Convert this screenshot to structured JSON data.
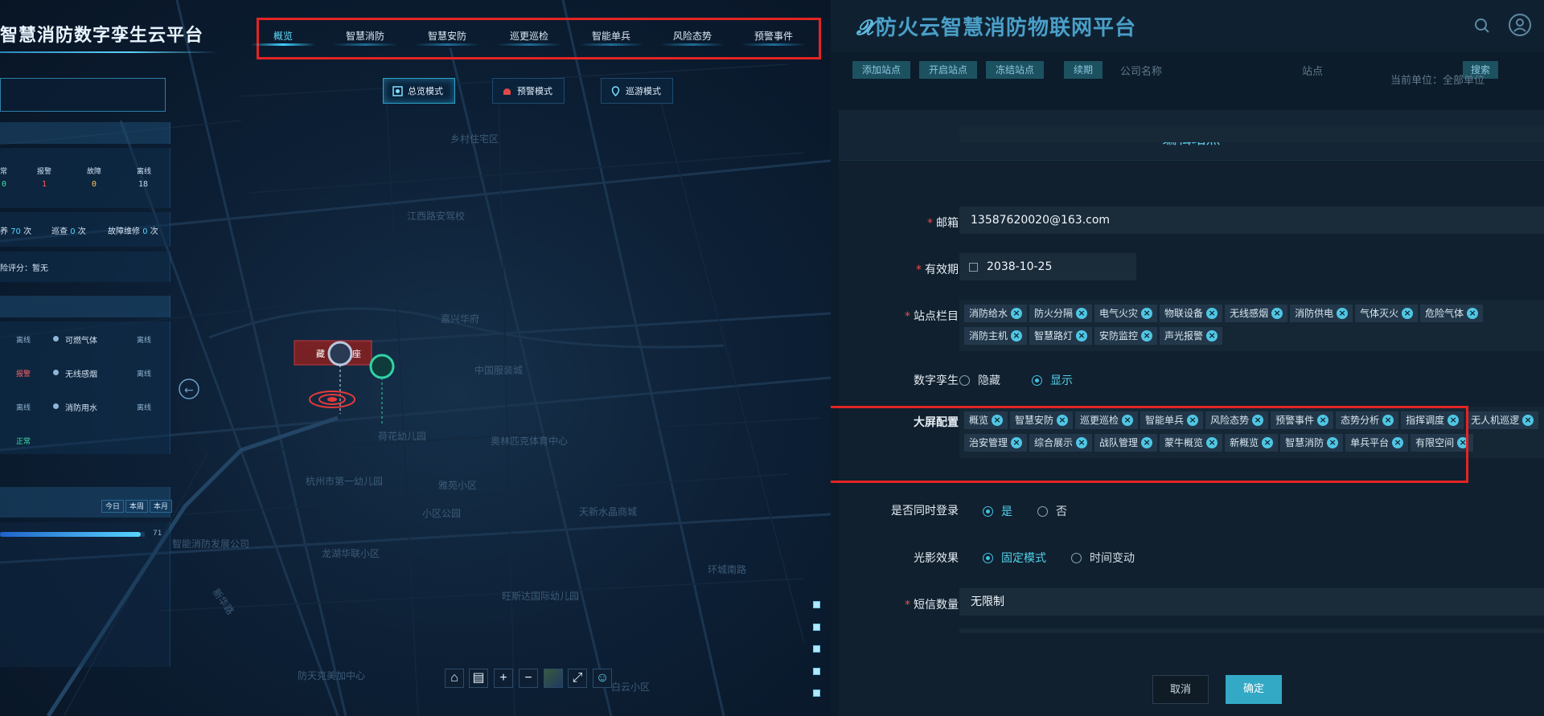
{
  "left": {
    "title": "智慧消防数字孪生云平台",
    "nav": [
      "概览",
      "智慧消防",
      "智慧安防",
      "巡更巡检",
      "智能单兵",
      "风险态势",
      "预警事件"
    ],
    "nav_active": "概览",
    "modes": [
      "总览模式",
      "预警模式",
      "巡游模式"
    ],
    "mode_active": "总览模式",
    "stats": [
      {
        "label": "常",
        "value": "0"
      },
      {
        "label": "报警",
        "value": "1"
      },
      {
        "label": "故障",
        "value": "0"
      },
      {
        "label": "离线",
        "value": "18"
      }
    ],
    "counts": [
      {
        "label": "养",
        "value": "70",
        "unit": "次"
      },
      {
        "label": "巡查",
        "value": "0",
        "unit": "次"
      },
      {
        "label": "故障维修",
        "value": "0",
        "unit": "次"
      }
    ],
    "risk_text": "险评分：暂无",
    "status_rows": [
      {
        "left": "离线",
        "name": "可燃气体",
        "right": "离线"
      },
      {
        "left": "报警",
        "name": "无线感烟",
        "right": "离线"
      },
      {
        "left": "离线",
        "name": "消防用水",
        "right": "离线"
      },
      {
        "left": "正常",
        "name": "",
        "right": ""
      }
    ],
    "period_tabs": [
      "今日",
      "本周",
      "本月"
    ],
    "progress_value": "71",
    "progress_fraction": 0.97,
    "marker_label": "藏",
    "marker_suffix": "座",
    "map_labels": [
      "江西路安驾校",
      "乡村住宅区",
      "中国服装城",
      "奥林匹克体育中心",
      "杭州市第一幼儿园",
      "雅苑小区",
      "荷花幼儿园",
      "旺斯达国际幼儿园",
      "防天克美加中心",
      "白云小区",
      "新华路",
      "环城南路",
      "智能消防发展公司",
      "天新水晶商城",
      "嘉兴华府",
      "龙湖华联小区",
      "小区公园"
    ],
    "toolbar_icons": [
      "home-icon",
      "building-icon",
      "zoom-in-icon",
      "zoom-out-icon",
      "satellite-icon",
      "fullscreen-icon",
      "robot-icon"
    ]
  },
  "right": {
    "brand": "防火云智慧消防物联网平台",
    "bg_buttons": [
      "添加站点",
      "开启站点",
      "冻结站点",
      "续期"
    ],
    "bg_company_label": "公司名称",
    "bg_site_label": "站点",
    "bg_search": "搜索",
    "bg_unit": "当前单位：全部单位",
    "modal_title": "编辑站点",
    "fields": {
      "email_label": "邮箱",
      "email_value": "13587620020@163.com",
      "expiry_label": "有效期",
      "expiry_value": "2038-10-25",
      "columns_label": "站点栏目",
      "columns_tags": [
        "消防给水",
        "防火分隔",
        "电气火灾",
        "物联设备",
        "无线感烟",
        "消防供电",
        "气体灭火",
        "危险气体",
        "消防主机",
        "智慧路灯",
        "安防监控",
        "声光报警"
      ],
      "twin_label": "数字孪生",
      "twin_options": [
        "隐藏",
        "显示"
      ],
      "twin_selected": "显示",
      "screen_label": "大屏配置",
      "screen_tags": [
        "概览",
        "智慧安防",
        "巡更巡检",
        "智能单兵",
        "风险态势",
        "预警事件",
        "态势分析",
        "指挥调度",
        "无人机巡逻",
        "治安管理",
        "综合展示",
        "战队管理",
        "蒙牛概览",
        "新概览",
        "智慧消防",
        "单兵平台",
        "有限空间"
      ],
      "login_label": "是否同时登录",
      "login_options": [
        "是",
        "否"
      ],
      "login_selected": "是",
      "light_label": "光影效果",
      "light_options": [
        "固定模式",
        "时间变动"
      ],
      "light_selected": "固定模式",
      "sms_label": "短信数量",
      "sms_value": "无限制"
    },
    "cancel_label": "取消",
    "ok_label": "确定"
  },
  "colors": {
    "accent": "#40c3e4",
    "highlight_box": "#e32424",
    "required": "#f04c4c"
  }
}
